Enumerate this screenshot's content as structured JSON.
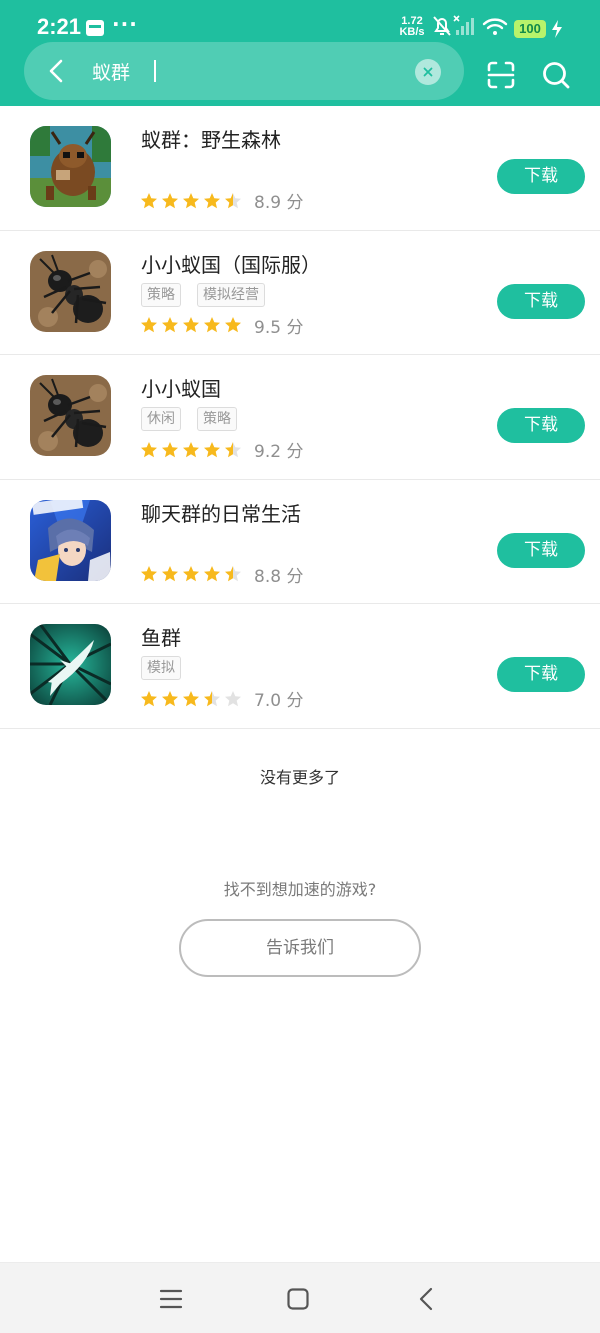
{
  "status_bar": {
    "time": "2:21",
    "more": "···",
    "net_speed_value": "1.72",
    "net_speed_unit": "KB/s",
    "battery": "100"
  },
  "search": {
    "query": "蚁群",
    "back_icon": "chevron-left-icon",
    "clear_icon": "close-icon",
    "scan_icon": "scan-icon",
    "search_icon": "search-icon"
  },
  "results": [
    {
      "title": "蚁群：野生森林",
      "tags": [],
      "rating": 4.5,
      "score": "8.9 分",
      "button": "下载",
      "icon_theme": "pixel-ant"
    },
    {
      "title": "小小蚁国（国际服）",
      "tags": [
        "策略",
        "模拟经营"
      ],
      "rating": 5,
      "score": "9.5 分",
      "button": "下载",
      "icon_theme": "ant"
    },
    {
      "title": "小小蚁国",
      "tags": [
        "休闲",
        "策略"
      ],
      "rating": 4.5,
      "score": "9.2 分",
      "button": "下载",
      "icon_theme": "ant"
    },
    {
      "title": "聊天群的日常生活",
      "tags": [],
      "rating": 4.5,
      "score": "8.8 分",
      "button": "下载",
      "icon_theme": "anime"
    },
    {
      "title": "鱼群",
      "tags": [
        "模拟"
      ],
      "rating": 3.5,
      "score": "7.0 分",
      "button": "下载",
      "icon_theme": "fish"
    }
  ],
  "footer": {
    "no_more": "没有更多了",
    "cant_find": "找不到想加速的游戏?",
    "tell_us": "告诉我们"
  },
  "nav": {
    "menu_icon": "menu-icon",
    "home_icon": "home-icon",
    "back_icon": "back-icon"
  },
  "colors": {
    "accent": "#1fbf9f",
    "star": "#f7b91d",
    "star_empty": "#e2e2e2"
  }
}
